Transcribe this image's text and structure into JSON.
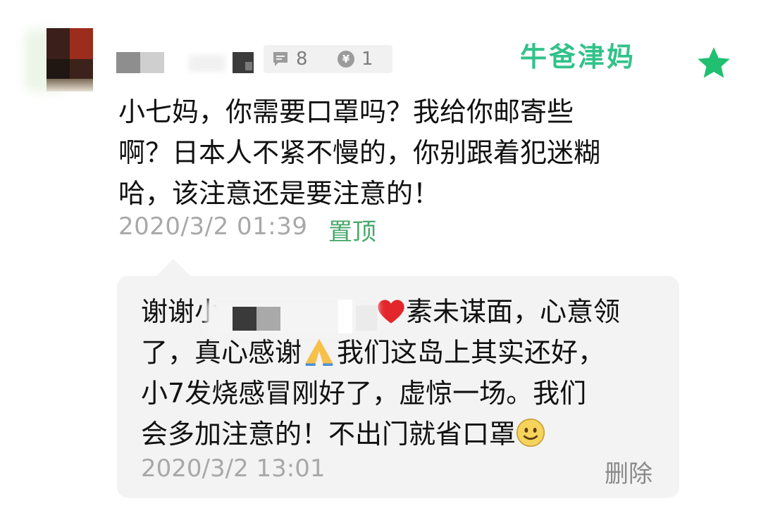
{
  "header": {
    "message_count": "8",
    "coin_count": "1",
    "coin_symbol": "¥",
    "watermark": "牛爸津妈"
  },
  "comment": {
    "line1": "小七妈，你需要口罩吗？我给你邮寄些",
    "line2": "啊？日本人不紧不慢的，你别跟着犯迷糊",
    "line3": "哈，该注意还是要注意的！",
    "timestamp": "2020/3/2 01:39",
    "pin_label": "置顶"
  },
  "reply": {
    "greeting": "谢谢小",
    "line1_rest": "素未谋面，心意领",
    "line2_a": "了，真心感谢",
    "line2_b": "我们这岛上其实还好，",
    "line3": "小7发烧感冒刚好了，虚惊一场。我们",
    "line4": "会多加注意的！不出门就省口罩",
    "timestamp": "2020/3/2 13:01",
    "delete_label": "删除"
  },
  "icons": [
    "message-icon",
    "coin-icon",
    "star-icon",
    "heart-emoji-icon",
    "praying-hands-emoji-icon",
    "smile-emoji-icon"
  ],
  "colors": {
    "accent_green": "#32c28a",
    "pin_green": "#4aa86b",
    "timestamp_gray": "#a8a8a8",
    "bubble_bg": "#f3f3f3"
  }
}
